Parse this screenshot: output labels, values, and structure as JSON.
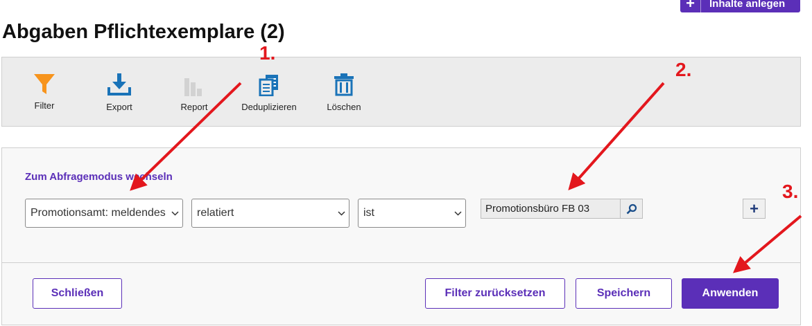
{
  "header": {
    "create_label": "Inhalte anlegen",
    "page_title": "Abgaben Pflichtexemplare (2)"
  },
  "toolbar": {
    "filter": "Filter",
    "export": "Export",
    "report": "Report",
    "dedup": "Deduplizieren",
    "delete": "Löschen"
  },
  "filter": {
    "mode_link": "Zum Abfragemodus wechseln",
    "field_select": "Promotionsamt: meldendes",
    "relation_select": "relatiert",
    "operator_select": "ist",
    "value": "Promotionsbüro FB 03"
  },
  "actions": {
    "close": "Schließen",
    "reset": "Filter zurücksetzen",
    "save": "Speichern",
    "apply": "Anwenden"
  },
  "annotations": [
    "1.",
    "2.",
    "3."
  ],
  "colors": {
    "accent": "#5b2fb8",
    "annotation": "#e3171d",
    "filter_icon": "#f7941d",
    "icon_blue": "#1a73b8"
  }
}
